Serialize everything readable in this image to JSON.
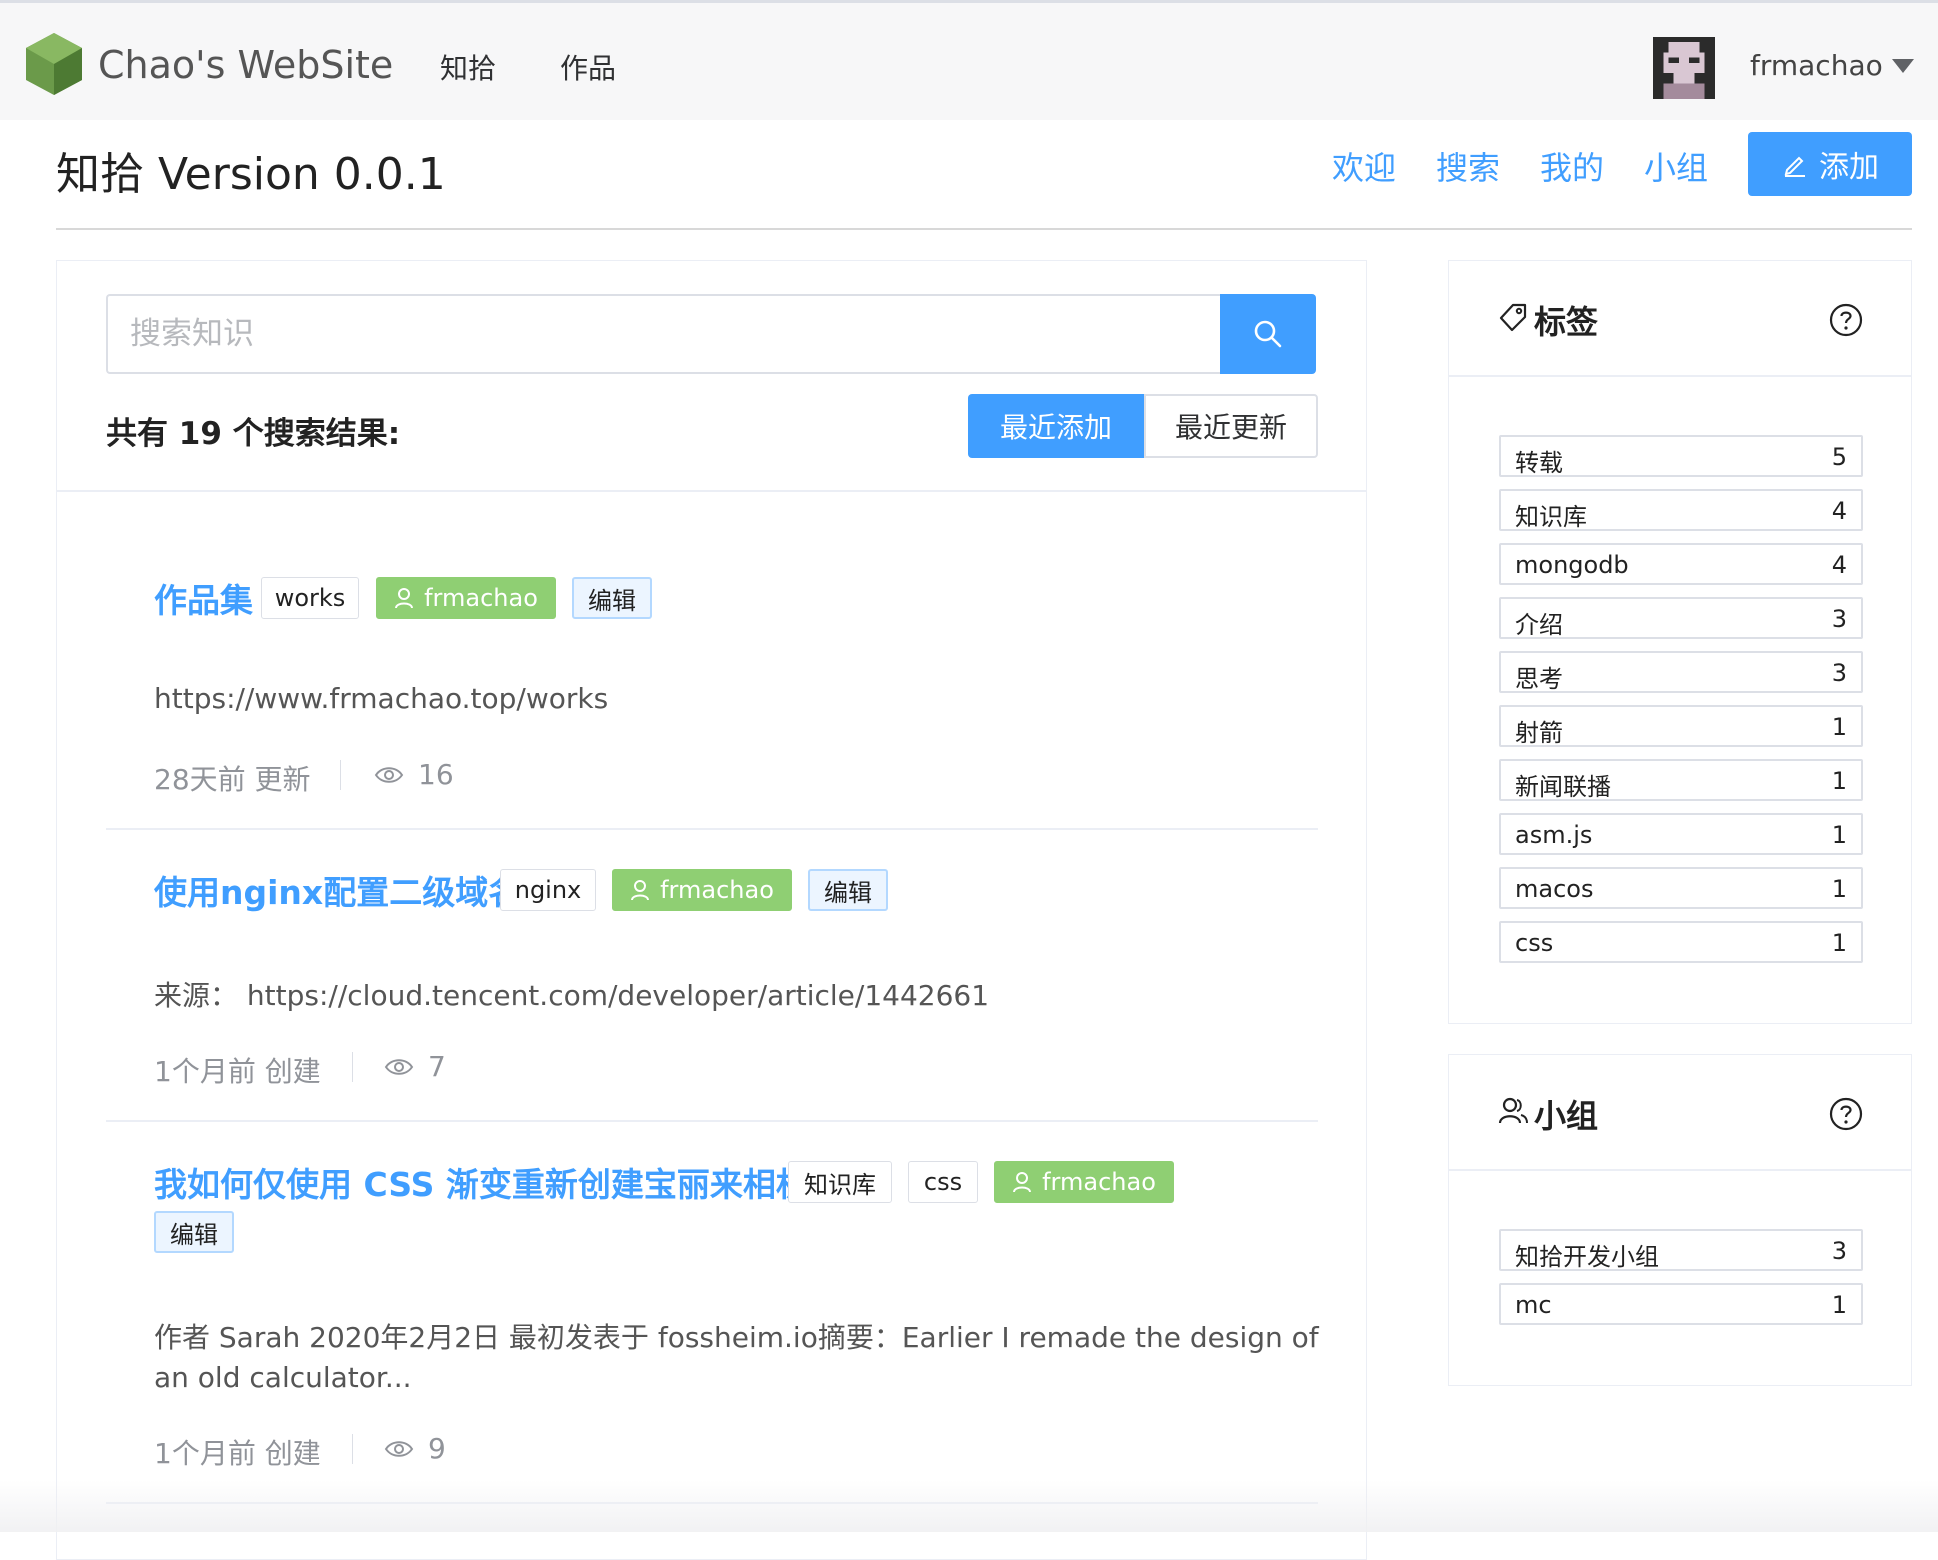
{
  "nav": {
    "brand": "Chao's WebSite",
    "links": [
      "知拾",
      "作品"
    ],
    "username": "frmachao"
  },
  "header": {
    "title": "知拾 Version 0.0.1",
    "links": [
      "欢迎",
      "搜索",
      "我的",
      "小组"
    ],
    "add_label": "添加"
  },
  "search": {
    "placeholder": "搜索知识",
    "result_count": "共有 19 个搜索结果:",
    "sort_recent_add": "最近添加",
    "sort_recent_update": "最近更新"
  },
  "articles": [
    {
      "title": "作品集",
      "tags": [
        "works"
      ],
      "author": "frmachao",
      "edit": "编辑",
      "body": "https://www.frmachao.top/works",
      "meta": "28天前 更新",
      "views": "16"
    },
    {
      "title": "使用nginx配置二级域名",
      "tags": [
        "nginx"
      ],
      "author": "frmachao",
      "edit": "编辑",
      "body": "来源： https://cloud.tencent.com/developer/article/1442661",
      "meta": "1个月前 创建",
      "views": "7"
    },
    {
      "title": "我如何仅使用 CSS 渐变重新创建宝丽来相机",
      "tags": [
        "知识库",
        "css"
      ],
      "author": "frmachao",
      "edit": "编辑",
      "body_line1": "作者 Sarah 2020年2月2日 最初发表于 fossheim.io摘要：Earlier I remade the design of",
      "body_line2": "an old calculator...",
      "meta": "1个月前 创建",
      "views": "9"
    }
  ],
  "tags_panel": {
    "title": "标签",
    "items": [
      {
        "label": "转载",
        "count": "5"
      },
      {
        "label": "知识库",
        "count": "4"
      },
      {
        "label": "mongodb",
        "count": "4"
      },
      {
        "label": "介绍",
        "count": "3"
      },
      {
        "label": "思考",
        "count": "3"
      },
      {
        "label": "射箭",
        "count": "1"
      },
      {
        "label": "新闻联播",
        "count": "1"
      },
      {
        "label": "asm.js",
        "count": "1"
      },
      {
        "label": "macos",
        "count": "1"
      },
      {
        "label": "css",
        "count": "1"
      }
    ]
  },
  "groups_panel": {
    "title": "小组",
    "items": [
      {
        "label": "知拾开发小组",
        "count": "3"
      },
      {
        "label": "mc",
        "count": "1"
      }
    ]
  },
  "colors": {
    "accent": "#409eff",
    "user_tag": "#8fcf73",
    "muted": "#909399"
  },
  "icons": [
    "hexagon-logo-icon",
    "search-icon",
    "edit-icon",
    "user-icon",
    "eye-icon",
    "tag-icon",
    "group-icon",
    "help-icon",
    "caret-down-icon"
  ]
}
